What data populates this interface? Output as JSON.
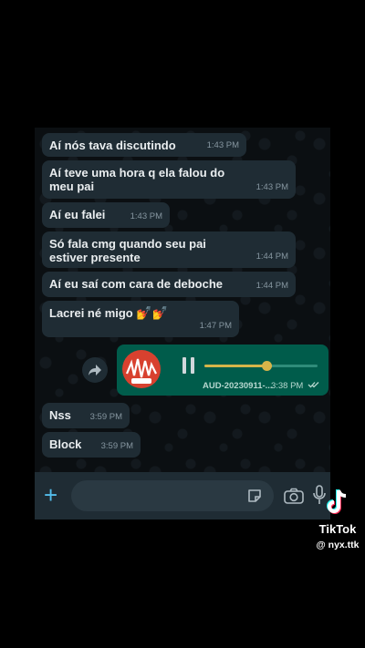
{
  "messages": [
    {
      "text": "Aí nós tava discutindo",
      "time": "1:43 PM"
    },
    {
      "text": "Aí teve uma hora q ela falou do meu pai",
      "time": "1:43 PM"
    },
    {
      "text": "Aí eu falei",
      "time": "1:43 PM"
    },
    {
      "text": "Só fala cmg quando seu pai estiver presente",
      "time": "1:44 PM"
    },
    {
      "text": "Aí eu saí com cara de deboche",
      "time": "1:44 PM"
    },
    {
      "text": "Lacrei né migo",
      "emoji": "💅💅",
      "time": "1:47 PM"
    },
    {
      "text": "Nss",
      "time": "3:59 PM"
    },
    {
      "text": "Block",
      "time": "3:59 PM"
    }
  ],
  "audio": {
    "filename": "AUD-20230911-...",
    "time": "3:38 PM",
    "progress": 0.55,
    "status_icon": "double-check-icon"
  },
  "input_bar": {
    "icons": [
      "plus-icon",
      "sticker-icon",
      "camera-icon",
      "microphone-icon"
    ]
  },
  "watermark": {
    "brand": "TikTok",
    "username": "@ nyx.ttk"
  },
  "colors": {
    "incoming_bubble": "#1f2c34",
    "outgoing_bubble": "#005c4b",
    "accent": "#53bdeb",
    "audio_progress": "#d6b449"
  }
}
